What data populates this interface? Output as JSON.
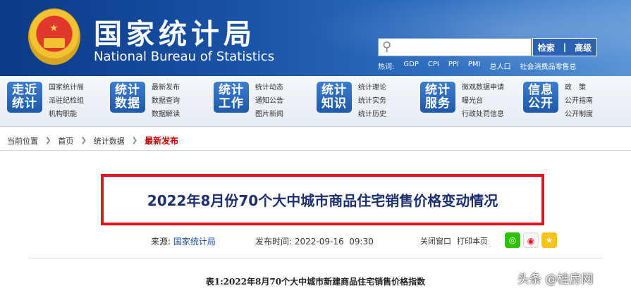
{
  "header": {
    "site_name_cn": "国家统计局",
    "site_name_en": "National Bureau of Statistics",
    "search": {
      "button_search": "检索",
      "button_advanced": "高级",
      "placeholder": ""
    },
    "hot_label": "热词:",
    "hot_words": [
      "GDP",
      "CPI",
      "PPI",
      "PMI",
      "总人口",
      "社会消费品零售总"
    ]
  },
  "nav": [
    {
      "badge": [
        "走近",
        "统计"
      ],
      "links": [
        "国家统计局",
        "派驻纪检组",
        "机构职能"
      ]
    },
    {
      "badge": [
        "统计",
        "数据"
      ],
      "links": [
        "最新发布",
        "数据查询",
        "数据解读"
      ]
    },
    {
      "badge": [
        "统计",
        "工作"
      ],
      "links": [
        "统计动态",
        "通知公告",
        "图片新闻"
      ]
    },
    {
      "badge": [
        "统计",
        "知识"
      ],
      "links": [
        "统计理论",
        "统计实务",
        "统计历史"
      ]
    },
    {
      "badge": [
        "统计",
        "服务"
      ],
      "links": [
        "微观数据申请",
        "曝光台",
        "行政处罚信息"
      ]
    },
    {
      "badge": [
        "信息",
        "公开"
      ],
      "links": [
        "政　策",
        "公开指南",
        "公开制度"
      ]
    }
  ],
  "breadcrumb": {
    "items": [
      "当前位置",
      "首页",
      "统计数据"
    ],
    "current": "最新发布"
  },
  "article": {
    "title": "2022年8月份70个大中城市商品住宅销售价格变动情况",
    "source_label": "来源:",
    "source": "国家统计局",
    "time_label": "发布时间:",
    "time": "2022-09-16  09:30",
    "close_label": "关闭窗口",
    "print_label": "打印本页",
    "table_caption": "表1:2022年8月70个大中城市新建商品住宅销售价格指数"
  },
  "watermark": "头条 @桂房网",
  "colors": {
    "header_blue": "#0b3a87",
    "highlight_red": "#e0141b",
    "current_crumb": "#c00000",
    "title_navy": "#1c2f6e"
  }
}
